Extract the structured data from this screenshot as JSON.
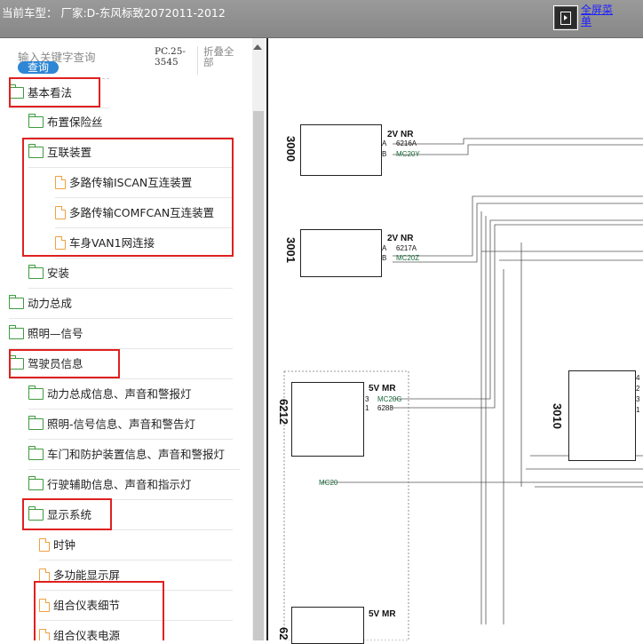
{
  "title": "当前车型：  厂家:D-东风标致2072011-2012",
  "fullscreen": {
    "icon": "fullscreen-icon",
    "label": "全屏菜单"
  },
  "search": {
    "placeholder": "输入关键字查询",
    "button": "查询"
  },
  "pc_code": "PC.25-3545",
  "collapse_all": "折叠全部",
  "tree": [
    {
      "label": "基本看法",
      "type": "folder"
    },
    {
      "label": "布置保险丝",
      "type": "folder"
    },
    {
      "label": "互联装置",
      "type": "folder"
    },
    {
      "label": "多路传输ISCAN互连装置",
      "type": "file"
    },
    {
      "label": "多路传输COMFCAN互连装置",
      "type": "file"
    },
    {
      "label": "车身VAN1网连接",
      "type": "file"
    },
    {
      "label": "安装",
      "type": "folder"
    },
    {
      "label": "动力总成",
      "type": "folder"
    },
    {
      "label": "照明—信号",
      "type": "folder"
    },
    {
      "label": "驾驶员信息",
      "type": "folder"
    },
    {
      "label": "动力总成信息、声音和警报灯",
      "type": "folder"
    },
    {
      "label": "照明-信号信息、声音和警告灯",
      "type": "folder"
    },
    {
      "label": "车门和防护装置信息、声音和警报灯",
      "type": "folder"
    },
    {
      "label": "行驶辅助信息、声音和指示灯",
      "type": "folder"
    },
    {
      "label": "显示系统",
      "type": "folder"
    },
    {
      "label": "时钟",
      "type": "file"
    },
    {
      "label": "多功能显示屏",
      "type": "file"
    },
    {
      "label": "组合仪表细节",
      "type": "file"
    },
    {
      "label": "组合仪表电源",
      "type": "file"
    }
  ],
  "diagram": {
    "components": [
      {
        "id": "3000",
        "volt": "2V NR",
        "pins": [
          "A",
          "B"
        ],
        "wires": [
          "6216A",
          "MC20Y"
        ]
      },
      {
        "id": "3001",
        "volt": "2V NR",
        "pins": [
          "A",
          "B"
        ],
        "wires": [
          "6217A",
          "MC20Z"
        ]
      },
      {
        "id": "6212",
        "volt": "5V MR",
        "pins": [
          "3",
          "1"
        ],
        "wires": [
          "MC20G",
          "6288"
        ]
      },
      {
        "id": "3010",
        "pins": [
          "4",
          "2",
          "3",
          "1"
        ]
      },
      {
        "id": "62",
        "volt": "5V MR"
      }
    ],
    "mc20": "MC20"
  }
}
